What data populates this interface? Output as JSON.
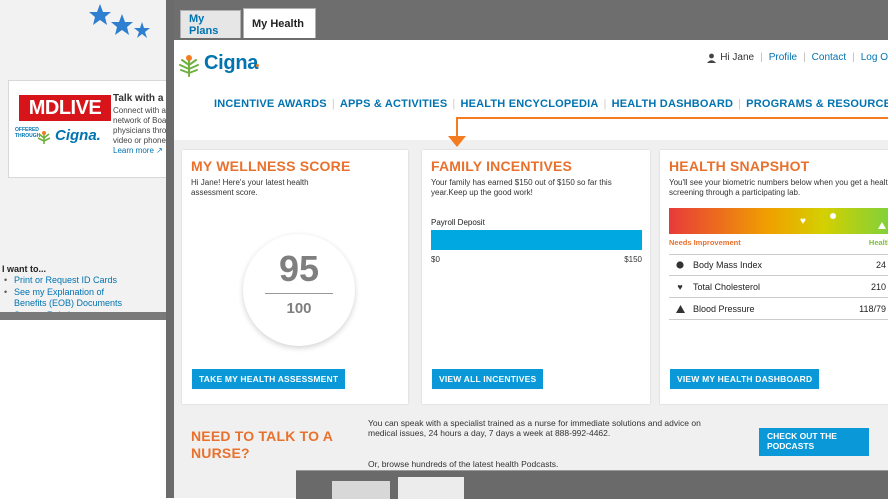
{
  "back_window": {
    "mdlive": {
      "logo": "MDLIVE",
      "offered_by": "OFFERED THROUGH",
      "brand": "Cigna.",
      "title": "Talk with a d",
      "description": "Connect with a\nnetwork of Boa\nphysicians thro\nvideo or phone",
      "learn_more": "Learn more"
    },
    "i_want_to": {
      "title": "I want to...",
      "items": [
        "Print or Request ID Cards",
        "See my Explanation of Benefits (EOB) Documents",
        "See my Reimbursement Requests"
      ]
    }
  },
  "tabs": [
    {
      "label": "My Plans",
      "active": false
    },
    {
      "label": "My Health",
      "active": true
    }
  ],
  "header": {
    "brand": "Cigna",
    "greeting": "Hi Jane",
    "profile": "Profile",
    "contact": "Contact",
    "logout": "Log O"
  },
  "nav": [
    "INCENTIVE AWARDS",
    "APPS & ACTIVITIES",
    "HEALTH ENCYCLOPEDIA",
    "HEALTH DASHBOARD",
    "PROGRAMS & RESOURCES +"
  ],
  "wellness": {
    "title": "MY WELLNESS SCORE",
    "description": "Hi Jane! Here's your latest health assessment score.",
    "score": "95",
    "total": "100",
    "button": "TAKE MY HEALTH ASSESSMENT"
  },
  "family": {
    "title": "FAMILY INCENTIVES",
    "description": "Your family has earned $150 out of $150 so far this year.Keep up the good work!",
    "payroll_label": "Payroll Deposit",
    "progress_fraction": 1.0,
    "min_label": "$0",
    "max_label": "$150",
    "button": "VIEW ALL INCENTIVES"
  },
  "snapshot": {
    "title": "HEALTH SNAPSHOT",
    "description": "You'll see your biometric numbers below when you get a health screening through a participating lab.",
    "needs_label": "Needs Improvement",
    "healthy_label": "Healthy",
    "metrics": [
      {
        "icon": "circle-icon",
        "name": "Body Mass Index",
        "value": "24"
      },
      {
        "icon": "heart-icon",
        "name": "Total Cholesterol",
        "value": "210"
      },
      {
        "icon": "triangle-icon",
        "name": "Blood Pressure",
        "value": "118/79"
      }
    ],
    "button": "VIEW MY HEALTH DASHBOARD"
  },
  "nurse": {
    "title_line1": "NEED TO TALK TO A",
    "title_line2": "NURSE?",
    "text": "You can speak with a specialist trained as a nurse for immediate solutions and advice on medical issues, 24 hours a day, 7 days a week at 888-992-4462.",
    "browse": "Or, browse hundreds of the latest health Podcasts.",
    "button_line1": "CHECK OUT THE",
    "button_line2": "PODCASTS"
  },
  "colors": {
    "brand_blue": "#0073b1",
    "accent_orange": "#e8712d",
    "button_blue": "#0a98d8",
    "progress_blue": "#00a8e1"
  }
}
